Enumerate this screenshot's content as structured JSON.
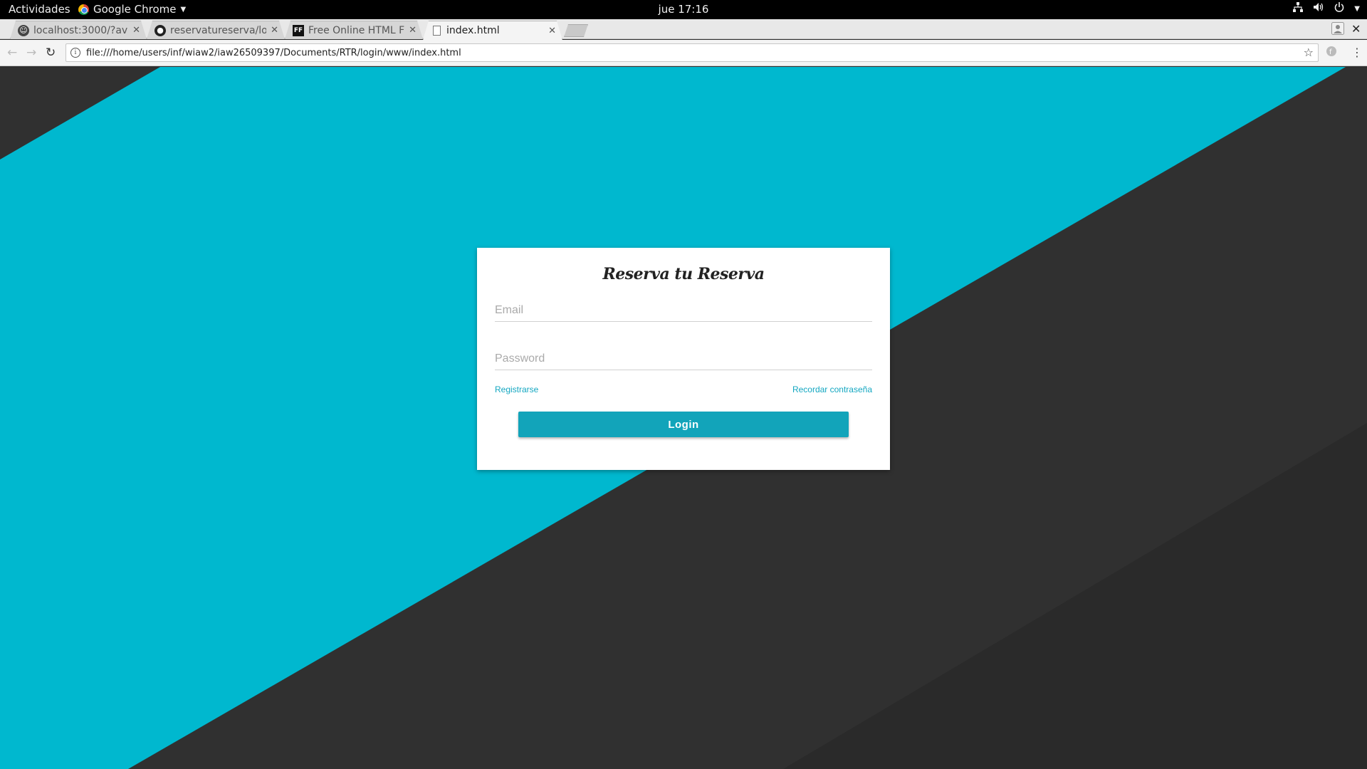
{
  "topbar": {
    "activities": "Actividades",
    "app_name": "Google Chrome",
    "clock": "jue 17:16"
  },
  "browser": {
    "tabs": [
      {
        "title": "localhost:3000/?av",
        "icon": "ghost-icon",
        "active": false
      },
      {
        "title": "reservatureserva/lo",
        "icon": "github-icon",
        "active": false
      },
      {
        "title": "Free Online HTML F",
        "icon": "ff-icon",
        "favicon_text": "FF",
        "active": false
      },
      {
        "title": "index.html",
        "icon": "document-icon",
        "active": true
      }
    ],
    "url": "file:///home/users/inf/wiaw2/iaw26509397/Documents/RTR/login/www/index.html"
  },
  "login": {
    "title": "Reserva tu Reserva",
    "email_placeholder": "Email",
    "password_placeholder": "Password",
    "register_link": "Registrarse",
    "forgot_link": "Recordar contraseña",
    "login_button": "Login"
  },
  "colors": {
    "accent": "#00b8cf",
    "button": "#12a4ba",
    "dark_background": "#2f2f2f"
  }
}
